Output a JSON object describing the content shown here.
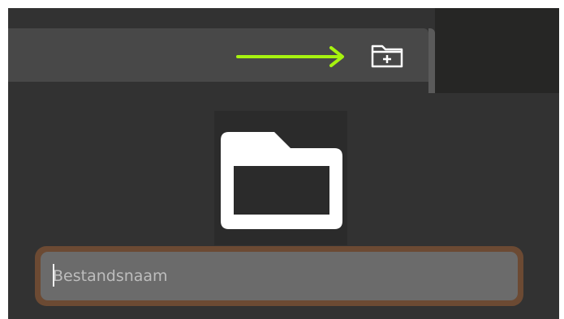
{
  "toolbar": {
    "new_folder_icon": "new-folder-icon",
    "annotation_arrow_color": "#a6f30f"
  },
  "preview": {
    "icon": "folder-icon",
    "icon_color": "#ffffff"
  },
  "filename": {
    "placeholder": "Bestandsnaam",
    "value": "",
    "focus_ring_color": "#6c4a33"
  },
  "colors": {
    "background": "#323232",
    "toolbar": "#484848",
    "input_bg": "#6b6b6b"
  }
}
